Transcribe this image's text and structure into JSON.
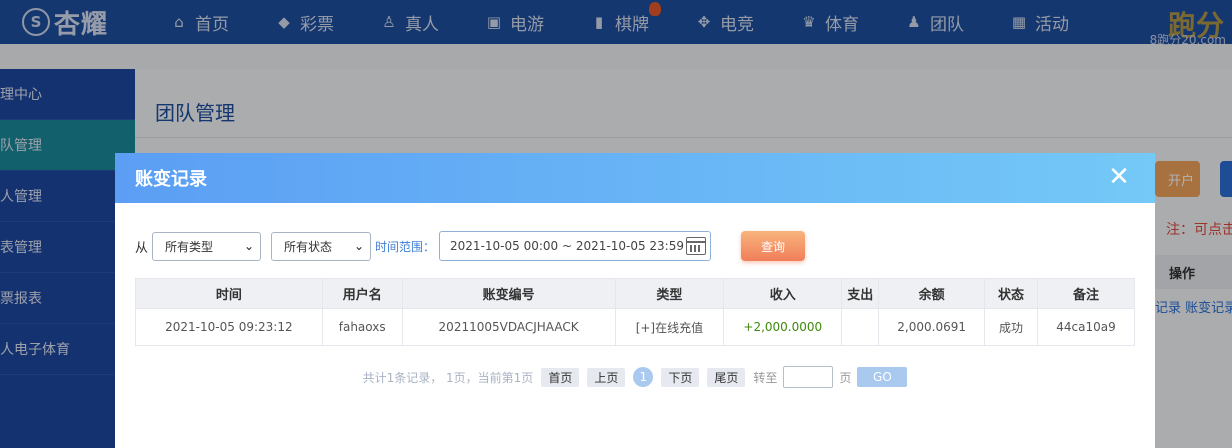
{
  "brand": {
    "logo_text": "杏耀",
    "logo_mark": "S",
    "corner_big": "跑分",
    "corner_small": "8跑分20.com"
  },
  "nav": [
    {
      "label": "首页",
      "icon": "home-icon",
      "glyph": "⌂"
    },
    {
      "label": "彩票",
      "icon": "ticket-icon",
      "glyph": "◆"
    },
    {
      "label": "真人",
      "icon": "person-icon",
      "glyph": "♙"
    },
    {
      "label": "电游",
      "icon": "arcade-icon",
      "glyph": "▣"
    },
    {
      "label": "棋牌",
      "icon": "cards-icon",
      "glyph": "▮"
    },
    {
      "label": "电竞",
      "icon": "gamepad-icon",
      "glyph": "✥"
    },
    {
      "label": "体育",
      "icon": "trophy-icon",
      "glyph": "♛"
    },
    {
      "label": "团队",
      "icon": "team-icon",
      "glyph": "♟"
    },
    {
      "label": "活动",
      "icon": "gift-icon",
      "glyph": "▦"
    }
  ],
  "sidebar": {
    "items": [
      {
        "label": "管理中心"
      },
      {
        "label": "团队管理"
      },
      {
        "label": "个人管理"
      },
      {
        "label": "报表管理"
      },
      {
        "label": "彩票报表"
      },
      {
        "label": "真人电子体育"
      }
    ]
  },
  "background": {
    "page_title": "团队管理",
    "btn_label": "开户",
    "note": "注：可点击",
    "col_header": "操作",
    "row_links": "记录  账变记录"
  },
  "modal": {
    "title": "账变记录",
    "close_glyph": "✕",
    "filter": {
      "from_label": "从",
      "type_value": "所有类型",
      "status_value": "所有状态",
      "range_label": "时间范围：",
      "date_range": "2021-10-05 00:00 ~ 2021-10-05 23:59",
      "query_label": "查询"
    },
    "table": {
      "headers": [
        "时间",
        "用户名",
        "账变编号",
        "类型",
        "收入",
        "支出",
        "余额",
        "状态",
        "备注"
      ],
      "rows": [
        [
          "2021-10-05 09:23:12",
          "fahaoxs",
          "20211005VDACJHAACK",
          "[+]在线充值",
          "+2,000.0000",
          "",
          "2,000.0691",
          "成功",
          "44ca10a9"
        ]
      ]
    },
    "pager": {
      "info": "共计1条记录， 1页，当前第1页",
      "first": "首页",
      "prev": "上页",
      "current": "1",
      "next": "下页",
      "last": "尾页",
      "goto_label": "转至",
      "page_unit": "页",
      "go": "GO"
    }
  },
  "colors": {
    "nav_bg": "#1f4fa0",
    "header_start": "#5b9ef4",
    "header_end": "#74c9f7",
    "query_btn": "#f07e5a",
    "income": "#3d8a0e"
  }
}
